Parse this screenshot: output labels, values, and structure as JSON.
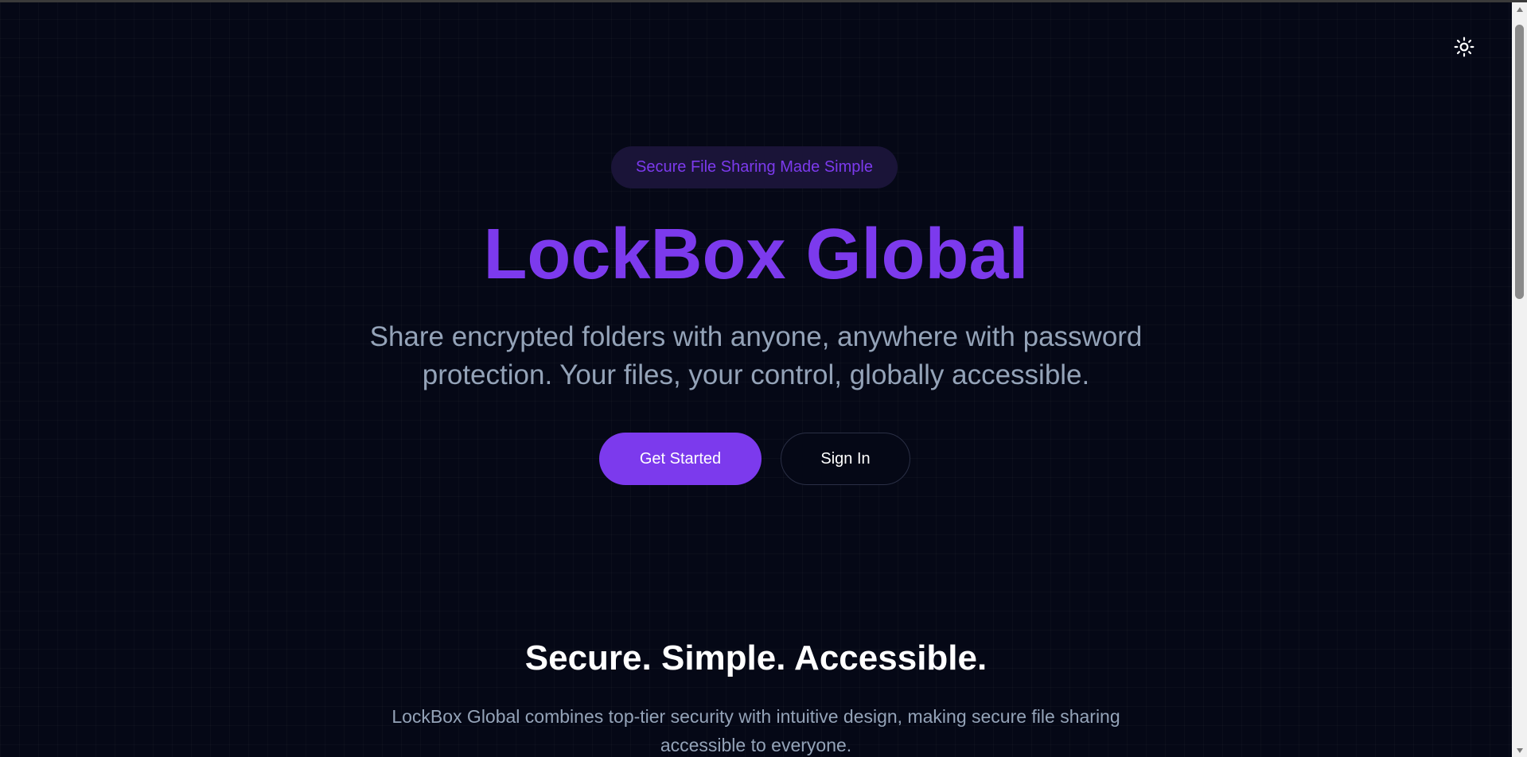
{
  "theme_toggle": {
    "icon": "sun-icon"
  },
  "hero": {
    "badge": "Secure File Sharing Made Simple",
    "title": "LockBox Global",
    "subtitle": "Share encrypted folders with anyone, anywhere with password protection. Your files, your control, globally accessible.",
    "primary_button": "Get Started",
    "secondary_button": "Sign In"
  },
  "features_section": {
    "title": "Secure. Simple. Accessible.",
    "text": "LockBox Global combines top-tier security with intuitive design, making secure file sharing accessible to everyone."
  },
  "colors": {
    "background": "#050816",
    "accent": "#7c3aed",
    "muted_text": "#94a3b8",
    "badge_bg": "#1a1438"
  }
}
